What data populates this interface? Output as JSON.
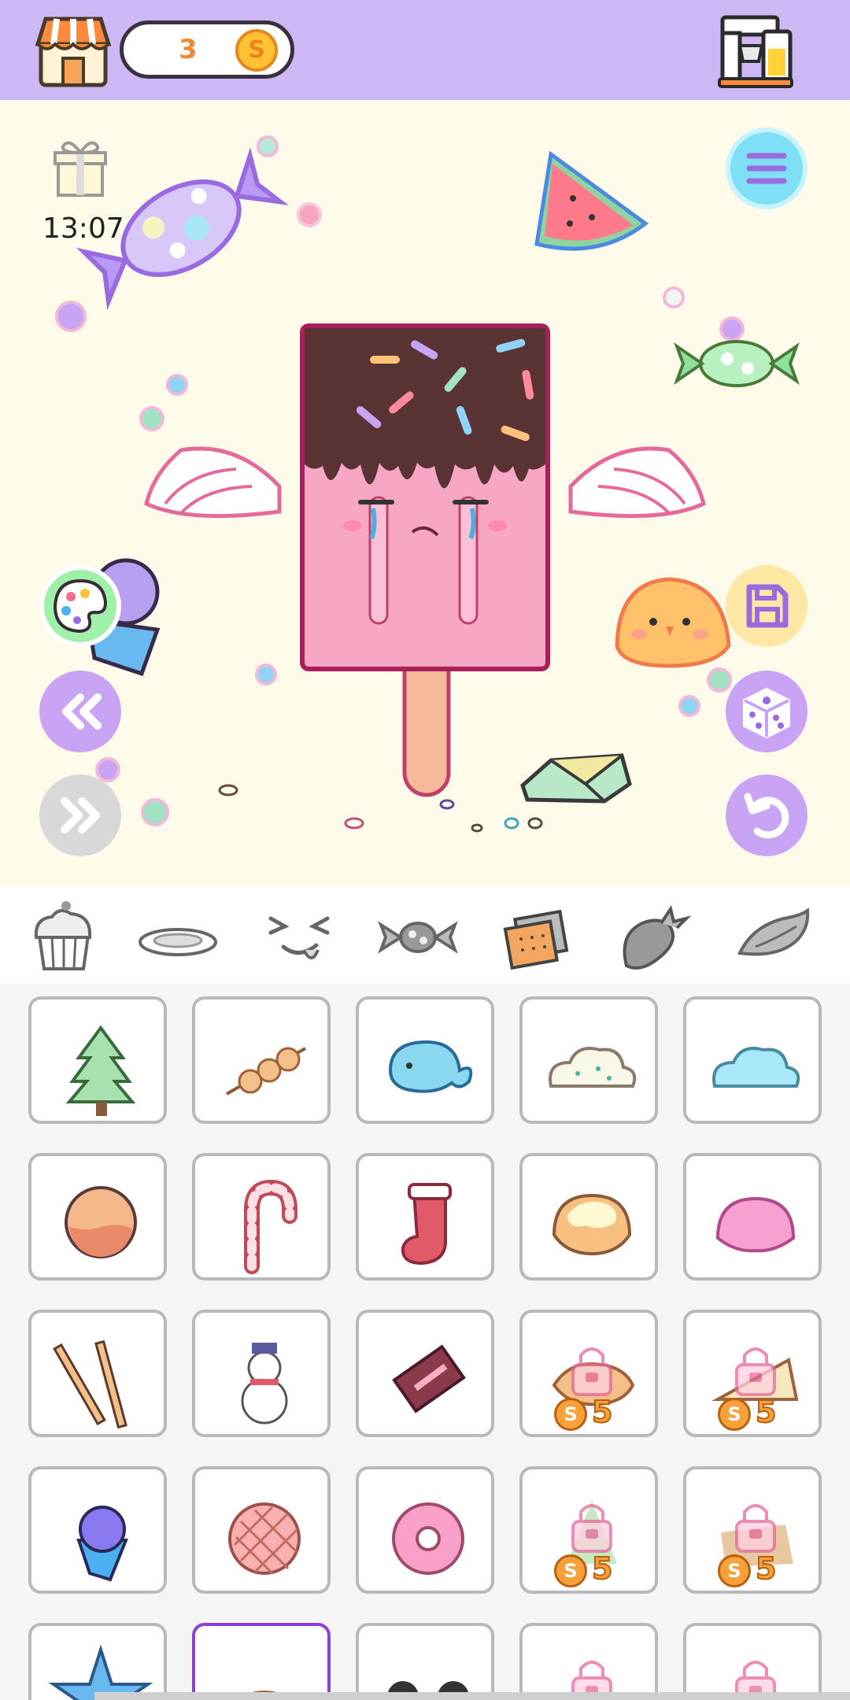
{
  "header": {
    "coins": "3",
    "coin_symbol": "S"
  },
  "stage": {
    "timer": "13:07",
    "colors": {
      "background": "#fffbea",
      "popsicle_chocolate": "#5a3334",
      "popsicle_pink": "#f7a7c4",
      "stick": "#f6b99a"
    }
  },
  "toolbar_left": {
    "palette": "palette-icon",
    "rewind": "rewind-icon",
    "forward": "fast-forward-icon"
  },
  "toolbar_right": {
    "menu": "menu-icon",
    "save": "save-icon",
    "random": "dice-icon",
    "undo": "undo-icon"
  },
  "categories": [
    {
      "name": "cupcake-icon"
    },
    {
      "name": "plate-icon"
    },
    {
      "name": "face-icon"
    },
    {
      "name": "candy-icon"
    },
    {
      "name": "cracker-icon",
      "selected": true
    },
    {
      "name": "strawberry-icon"
    },
    {
      "name": "wing-icon"
    }
  ],
  "items": [
    {
      "name": "christmas-tree",
      "locked": false
    },
    {
      "name": "dango-skewer",
      "locked": false
    },
    {
      "name": "whale",
      "locked": false
    },
    {
      "name": "cloud-sprinkles",
      "locked": false
    },
    {
      "name": "blue-cloud",
      "locked": false
    },
    {
      "name": "cookie-ball",
      "locked": false
    },
    {
      "name": "candy-cane",
      "locked": false
    },
    {
      "name": "christmas-stocking",
      "locked": false
    },
    {
      "name": "cream-bun",
      "locked": false
    },
    {
      "name": "pink-mochi",
      "locked": false
    },
    {
      "name": "wafer-sticks",
      "locked": false
    },
    {
      "name": "snowman",
      "locked": false
    },
    {
      "name": "chocolate-bar",
      "locked": false
    },
    {
      "name": "taiyaki",
      "locked": true,
      "price": "5"
    },
    {
      "name": "sandwich",
      "locked": true,
      "price": "5"
    },
    {
      "name": "ice-cream-cone",
      "locked": false
    },
    {
      "name": "melon-pan",
      "locked": false
    },
    {
      "name": "pink-donut",
      "locked": false
    },
    {
      "name": "mini-tree",
      "locked": true,
      "price": "5"
    },
    {
      "name": "toast",
      "locked": true,
      "price": "5"
    },
    {
      "name": "star",
      "locked": false
    },
    {
      "name": "chick-bun",
      "locked": false,
      "selected": true
    },
    {
      "name": "bow-ears",
      "locked": false
    },
    {
      "name": "round-locked",
      "locked": true
    },
    {
      "name": "round-locked-2",
      "locked": true
    }
  ]
}
